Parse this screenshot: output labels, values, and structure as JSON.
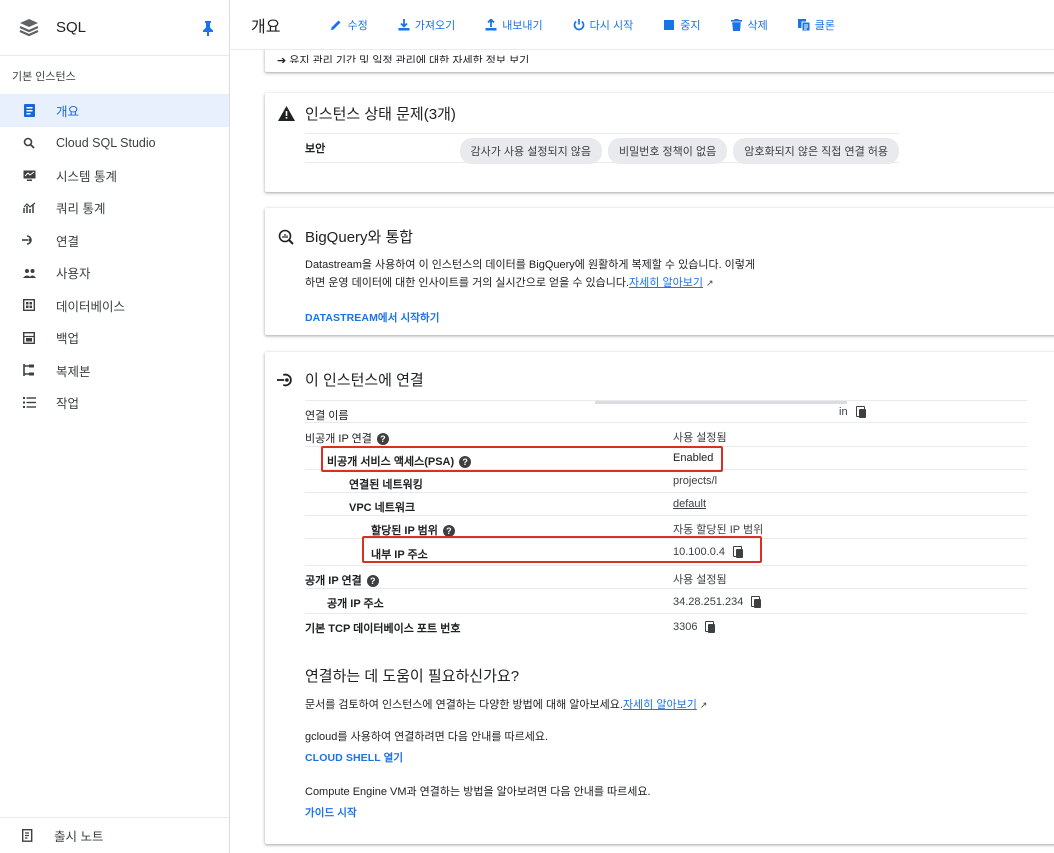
{
  "sidebar": {
    "product": "SQL",
    "section": "기본 인스턴스",
    "items": [
      {
        "label": "개요",
        "icon": "overview-icon",
        "active": true
      },
      {
        "label": "Cloud SQL Studio",
        "icon": "search-icon"
      },
      {
        "label": "시스템 통계",
        "icon": "monitor-icon"
      },
      {
        "label": "쿼리 통계",
        "icon": "chart-icon"
      },
      {
        "label": "연결",
        "icon": "connection-icon"
      },
      {
        "label": "사용자",
        "icon": "users-icon"
      },
      {
        "label": "데이터베이스",
        "icon": "database-icon"
      },
      {
        "label": "백업",
        "icon": "backup-icon"
      },
      {
        "label": "복제본",
        "icon": "replica-icon"
      },
      {
        "label": "작업",
        "icon": "list-icon"
      }
    ],
    "release_notes": "출시 노트"
  },
  "toolbar": {
    "title": "개요",
    "edit": "수정",
    "import": "가져오기",
    "export": "내보내기",
    "restart": "다시 시작",
    "stop": "중지",
    "delete": "삭제",
    "clone": "클론"
  },
  "cut_card": {
    "text": "유지 관리 기간 및 일정 관리에 대한 자세한 정보 보기"
  },
  "health": {
    "title": "인스턴스 상태 문제(3개)",
    "row_label": "보안",
    "chips": [
      "감사가 사용 설정되지 않음",
      "비밀번호 정책이 없음",
      "암호화되지 않은 직접 연결 허용"
    ]
  },
  "bigquery": {
    "title": "BigQuery와 통합",
    "line1": "Datastream을 사용하여 이 인스턴스의 데이터를 BigQuery에 원활하게 복제할 수 있습니다. 이렇게",
    "line2": "하면 운영 데이터에 대한 인사이트를 거의 실시간으로 얻을 수 있습니다.",
    "learn_more": "자세히 알아보기",
    "action": "DATASTREAM에서 시작하기"
  },
  "connect": {
    "title": "이 인스턴스에 연결",
    "rows": [
      {
        "key": "연결 이름",
        "value": "in"
      },
      {
        "key": "비공개 IP 연결",
        "value": "사용 설정됨"
      },
      {
        "key": "비공개 서비스 액세스(PSA)",
        "value": "Enabled"
      },
      {
        "key": "연결된 네트워킹",
        "value": "projects/l"
      },
      {
        "key": "VPC 네트워크",
        "value": "default"
      },
      {
        "key": "할당된 IP 범위",
        "value": "자동 할당된 IP 범위"
      },
      {
        "key": "내부 IP 주소",
        "value": "10.100.0.4"
      },
      {
        "key": "공개 IP 연결",
        "value": "사용 설정됨"
      },
      {
        "key": "공개 IP 주소",
        "value": "34.28.251.234"
      },
      {
        "key": "기본 TCP 데이터베이스 포트 번호",
        "value": "3306"
      }
    ],
    "help_title": "연결하는 데 도움이 필요하신가요?",
    "help_text": "문서를 검토하여 인스턴스에 연결하는 다양한 방법에 대해 알아보세요.",
    "help_link": "자세히 알아보기",
    "gcloud_text": "gcloud를 사용하여 연결하려면 다음 안내를 따르세요.",
    "gcloud_action": "CLOUD SHELL 열기",
    "vm_text": "Compute Engine VM과 연결하는 방법을 알아보려면 다음 안내를 따르세요.",
    "vm_action": "가이드 시작"
  },
  "colors": {
    "accent": "#1a73e8",
    "highlight": "#d93025",
    "active_bg": "#e8f0fe"
  }
}
